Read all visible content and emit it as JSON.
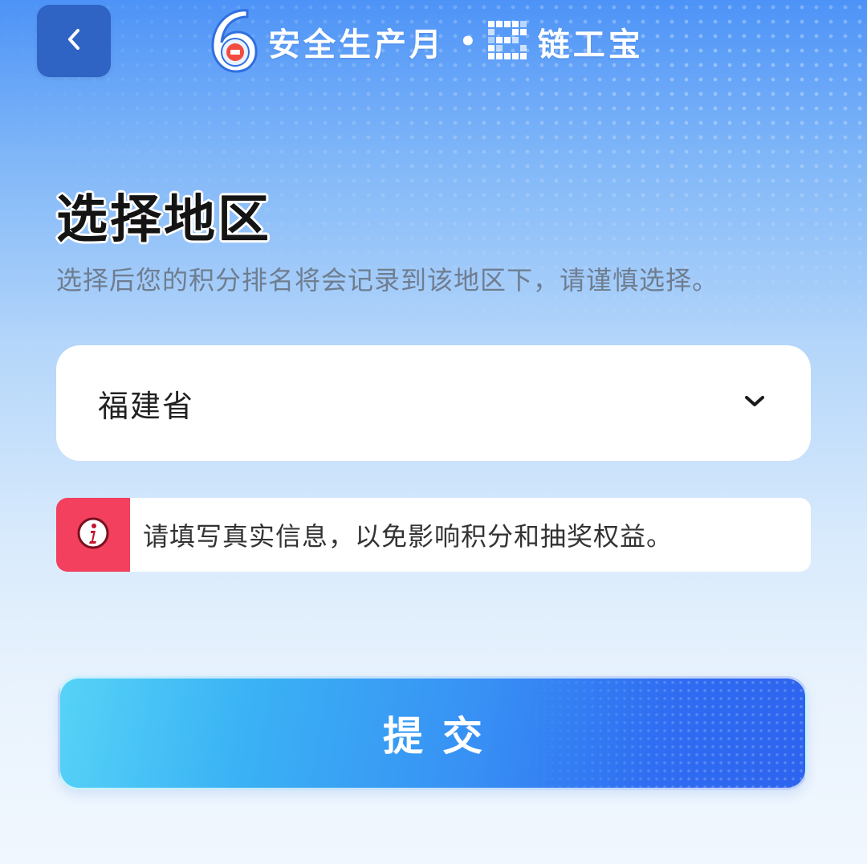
{
  "header": {
    "brand_left": "安全生产月",
    "separator": "•",
    "brand_right": "链工宝",
    "back_icon": "chevron-left-icon"
  },
  "page": {
    "title": "选择地区",
    "subtitle": "选择后您的积分排名将会记录到该地区下，请谨慎选择。"
  },
  "region_select": {
    "value": "福建省",
    "icon": "chevron-down-icon"
  },
  "notice": {
    "icon": "info-icon",
    "text": "请填写真实信息，以免影响积分和抽奖权益。",
    "color": "#f2405e"
  },
  "submit": {
    "label": "提交",
    "accent_start": "#56d3f6",
    "accent_end": "#2d63ef"
  }
}
